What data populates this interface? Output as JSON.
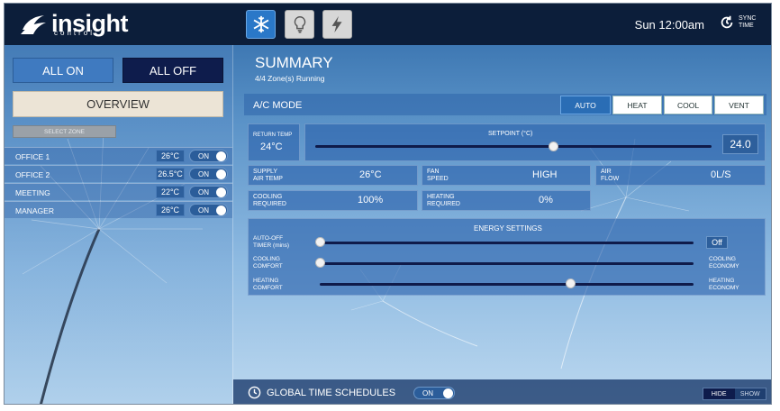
{
  "brand": {
    "name": "insight",
    "tagline": "control"
  },
  "header": {
    "mode_buttons": [
      {
        "name": "cooling-mode",
        "icon": "snowflake-icon",
        "active": true
      },
      {
        "name": "lighting-mode",
        "icon": "lightbulb-icon",
        "active": false
      },
      {
        "name": "power-mode",
        "icon": "lightning-icon",
        "active": false
      }
    ],
    "clock": "Sun 12:00am",
    "sync_label": "SYNC TIME"
  },
  "sidebar": {
    "all_on": "ALL ON",
    "all_off": "ALL OFF",
    "overview": "OVERVIEW",
    "select_zone": "SELECT ZONE",
    "zones": [
      {
        "name": "OFFICE 1",
        "temp": "26°C",
        "state": "ON"
      },
      {
        "name": "OFFICE 2",
        "temp": "26.5°C",
        "state": "ON"
      },
      {
        "name": "MEETING",
        "temp": "22°C",
        "state": "ON"
      },
      {
        "name": "MANAGER",
        "temp": "26°C",
        "state": "ON"
      }
    ]
  },
  "summary": {
    "title": "SUMMARY",
    "subtitle": "4/4 Zone(s) Running",
    "ac_mode_label": "A/C MODE",
    "modes": [
      "AUTO",
      "HEAT",
      "COOL",
      "VENT"
    ],
    "selected_mode": "AUTO",
    "return_temp_label": "RETURN TEMP",
    "return_temp": "24°C",
    "setpoint_label": "SETPOINT (°C)",
    "setpoint": "24.0",
    "setpoint_fraction": 0.6,
    "supply_label_1": "SUPPLY",
    "supply_label_2": "AIR TEMP",
    "supply_value": "26°C",
    "fan_label_1": "FAN",
    "fan_label_2": "SPEED",
    "fan_value": "HIGH",
    "air_label_1": "AIR",
    "air_label_2": "FLOW",
    "air_value": "0L/S",
    "cooling_label_1": "COOLING",
    "cooling_label_2": "REQUIRED",
    "cooling_value": "100%",
    "heating_label_1": "HEATING",
    "heating_label_2": "REQUIRED",
    "heating_value": "0%"
  },
  "energy": {
    "title": "ENERGY SETTINGS",
    "auto_off_1": "AUTO-OFF",
    "auto_off_2": "TIMER (mins)",
    "auto_off_value": "Off",
    "auto_off_fraction": 0.0,
    "cooling_comfort_1": "COOLING",
    "cooling_comfort_2": "COMFORT",
    "cooling_economy_1": "COOLING",
    "cooling_economy_2": "ECONOMY",
    "cooling_fraction": 0.0,
    "heating_comfort_1": "HEATING",
    "heating_comfort_2": "COMFORT",
    "heating_economy_1": "HEATING",
    "heating_economy_2": "ECONOMY",
    "heating_fraction": 0.67
  },
  "footer": {
    "title": "GLOBAL TIME SCHEDULES",
    "toggle": "ON",
    "hide": "HIDE",
    "show": "SHOW"
  },
  "colors": {
    "accent": "#3f7ac0",
    "topbar": "#0c1e3a",
    "active_mode": "#2a78c8"
  }
}
